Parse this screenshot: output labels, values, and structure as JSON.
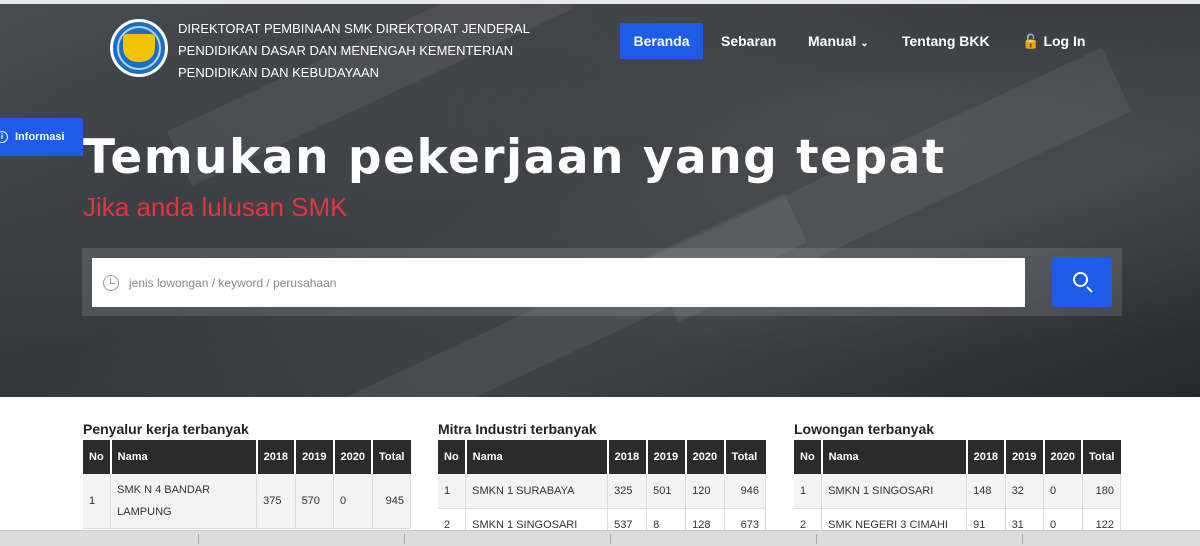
{
  "header": {
    "brand_lines": [
      "DIREKTORAT PEMBINAAN SMK DIREKTORAT JENDERAL",
      "PENDIDIKAN DASAR DAN MENENGAH KEMENTERIAN",
      "PENDIDIKAN DAN KEBUDAYAAN"
    ],
    "nav": {
      "beranda": "Beranda",
      "sebaran": "Sebaran",
      "manual": "Manual",
      "tentang": "Tentang BKK",
      "login": "Log In"
    },
    "accent_color": "#1e5be6"
  },
  "info_tab": "Informasi",
  "hero": {
    "headline": "Temukan pekerjaan yang tepat",
    "subline": "Jika anda lulusan SMK",
    "subline_color": "#e2353b",
    "search_placeholder": "jenis lowongan / keyword / perusahaan"
  },
  "tables": [
    {
      "title": "Penyalur kerja terbanyak",
      "headers": [
        "No",
        "Nama",
        "2018",
        "2019",
        "2020",
        "Total"
      ],
      "rows": [
        {
          "no": "1",
          "nama_l1": "SMK N 4 BANDAR",
          "nama_l2": "LAMPUNG",
          "y2018": "375",
          "y2019": "570",
          "y2020": "0",
          "total": "945"
        }
      ]
    },
    {
      "title": "Mitra Industri terbanyak",
      "headers": [
        "No",
        "Nama",
        "2018",
        "2019",
        "2020",
        "Total"
      ],
      "rows": [
        {
          "no": "1",
          "nama": "SMKN 1 SURABAYA",
          "y2018": "325",
          "y2019": "501",
          "y2020": "120",
          "total": "946"
        },
        {
          "no": "2",
          "nama": "SMKN 1 SINGOSARI",
          "y2018": "537",
          "y2019": "8",
          "y2020": "128",
          "total": "673"
        }
      ]
    },
    {
      "title": "Lowongan terbanyak",
      "headers": [
        "No",
        "Nama",
        "2018",
        "2019",
        "2020",
        "Total"
      ],
      "rows": [
        {
          "no": "1",
          "nama": "SMKN 1 SINGOSARI",
          "y2018": "148",
          "y2019": "32",
          "y2020": "0",
          "total": "180"
        },
        {
          "no": "2",
          "nama": "SMK NEGERI 3 CIMAHI",
          "y2018": "91",
          "y2019": "31",
          "y2020": "0",
          "total": "122"
        }
      ]
    }
  ]
}
